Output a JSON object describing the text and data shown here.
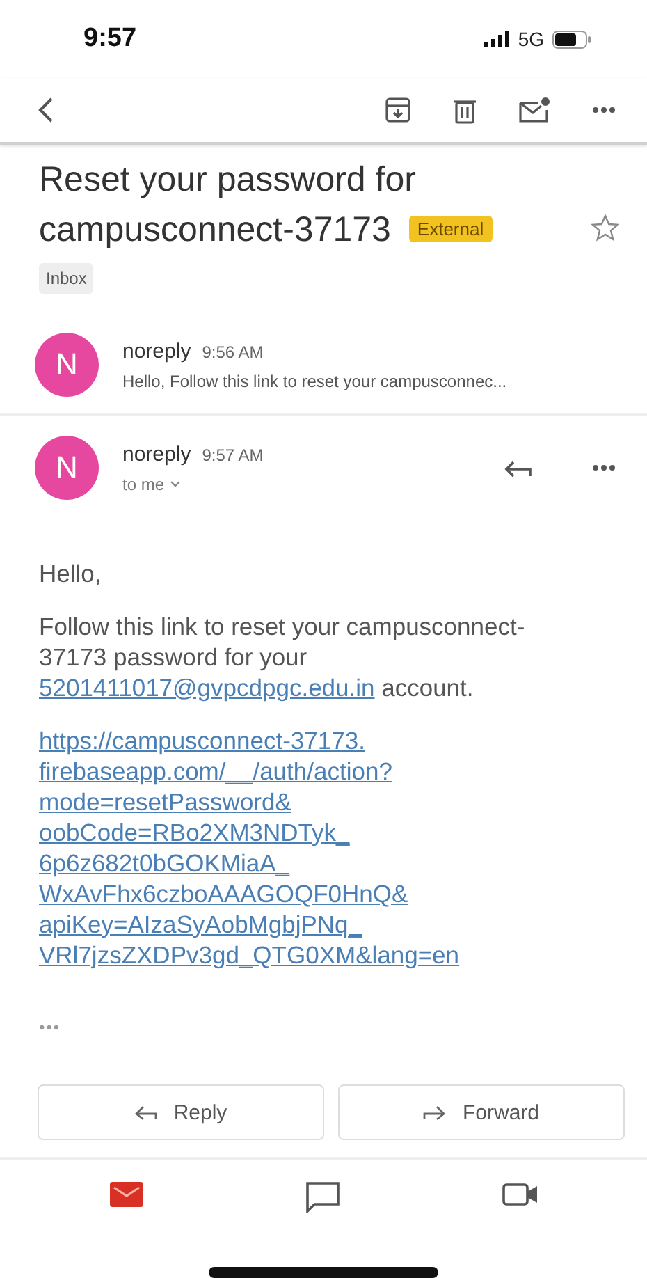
{
  "status_bar": {
    "time": "9:57",
    "network": "5G"
  },
  "subject": {
    "title": "Reset your password for campusconnect-37173",
    "badge": "External",
    "label": "Inbox",
    "starred": false
  },
  "messages": [
    {
      "kind": "collapsed",
      "avatar": "N",
      "sender": "noreply",
      "time": "9:56 AM",
      "snippet": "Hello, Follow this link to reset your campusconnec..."
    },
    {
      "kind": "expanded",
      "avatar": "N",
      "sender": "noreply",
      "time": "9:57 AM",
      "recipient": "to me"
    }
  ],
  "body": {
    "greeting": "Hello,",
    "text_before": "Follow this link to reset your campusconnect-37173 password for your ",
    "email": "5201411017@gvpcdpgc.edu.in",
    "text_after": " account.",
    "url_lines": [
      "https://campusconnect-37173.",
      "firebaseapp.com/__/auth/action?",
      "mode=resetPassword&",
      "oobCode=RBo2XM3NDTyk_",
      "6p6z682t0bGOKMiaA_",
      "WxAvFhx6czboAAAGOQF0HnQ&",
      "apiKey=AIzaSyAobMgbjPNq_",
      "VRl7jzsZXDPv3gd_QTG0XM&lang=en"
    ],
    "more": "•••"
  },
  "actions": [
    {
      "kind": "reply",
      "label": "Reply"
    },
    {
      "kind": "forward",
      "label": "Forward"
    }
  ],
  "nav": [
    {
      "kind": "mail",
      "selected": true
    },
    {
      "kind": "chat",
      "selected": false
    },
    {
      "kind": "video",
      "selected": false
    }
  ]
}
